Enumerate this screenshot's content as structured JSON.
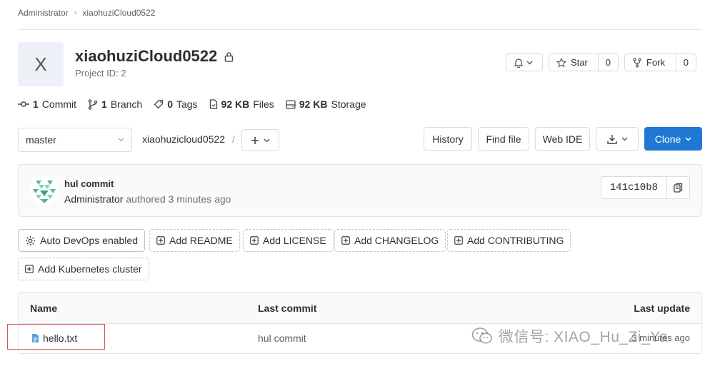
{
  "breadcrumb": {
    "root": "Administrator",
    "project": "xiaohuziCloud0522"
  },
  "project": {
    "avatar_letter": "X",
    "name": "xiaohuziCloud0522",
    "id_label": "Project ID: 2"
  },
  "actions": {
    "star_label": "Star",
    "star_count": "0",
    "fork_label": "Fork",
    "fork_count": "0"
  },
  "stats": {
    "commits_num": "1",
    "commits_label": "Commit",
    "branches_num": "1",
    "branches_label": "Branch",
    "tags_num": "0",
    "tags_label": "Tags",
    "files_num": "92 KB",
    "files_label": "Files",
    "storage_num": "92 KB",
    "storage_label": "Storage"
  },
  "repo_bar": {
    "branch": "master",
    "path": "xiaohuzicloud0522",
    "path_sep": "/",
    "history": "History",
    "find_file": "Find file",
    "web_ide": "Web IDE",
    "clone": "Clone"
  },
  "last_commit": {
    "title": "hul commit",
    "author": "Administrator",
    "meta": "authored 3 minutes ago",
    "sha": "141c10b8"
  },
  "suggestions": {
    "auto_devops": "Auto DevOps enabled",
    "add_readme": "Add README",
    "add_license": "Add LICENSE",
    "add_changelog": "Add CHANGELOG",
    "add_contributing": "Add CONTRIBUTING",
    "add_k8s": "Add Kubernetes cluster"
  },
  "table": {
    "col_name": "Name",
    "col_commit": "Last commit",
    "col_update": "Last update",
    "rows": [
      {
        "name": "hello.txt",
        "commit": "hul commit",
        "update": "3 minutes ago"
      }
    ]
  },
  "watermark": {
    "text": "微信号: XIAO_Hu_Zi_Ya"
  },
  "colors": {
    "primary": "#1f78d1",
    "highlight_box": "#d9534f"
  }
}
